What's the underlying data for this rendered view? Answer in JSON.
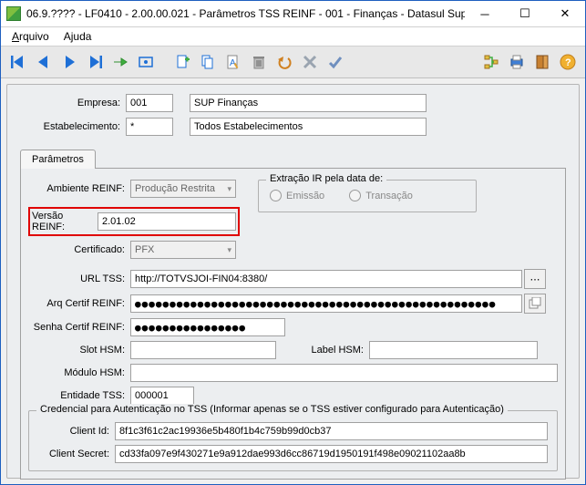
{
  "window": {
    "title": "06.9.???? - LF0410 - 2.00.00.021 - Parâmetros TSS REINF - 001 - Finanças - Datasul Suporte"
  },
  "menu": {
    "arquivo": "Arquivo",
    "ajuda": "Ajuda"
  },
  "toolbar": {
    "first": "first",
    "prev": "prev",
    "next": "next",
    "last": "last",
    "goto": "goto",
    "search": "search",
    "new": "new",
    "copy": "copy",
    "edit": "edit",
    "delete": "delete",
    "undo": "undo",
    "cancel": "cancel",
    "confirm": "confirm",
    "tree": "tree",
    "print": "print",
    "exit": "exit",
    "help": "help"
  },
  "header": {
    "empresa_label": "Empresa:",
    "empresa_code": "001",
    "empresa_name": "SUP Finanças",
    "estab_label": "Estabelecimento:",
    "estab_code": "*",
    "estab_name": "Todos Estabelecimentos"
  },
  "tabs": {
    "parametros": "Parâmetros"
  },
  "form": {
    "ambiente_label": "Ambiente REINF:",
    "ambiente_value": "Produção Restrita",
    "versao_label": "Versão REINF:",
    "versao_value": "2.01.02",
    "certificado_label": "Certificado:",
    "certificado_value": "PFX",
    "url_label": "URL TSS:",
    "url_value": "http://TOTVSJOI-FIN04:8380/",
    "arq_label": "Arq Certif REINF:",
    "arq_value": "●●●●●●●●●●●●●●●●●●●●●●●●●●●●●●●●●●●●●●●●●●●●●●●●●●●●",
    "senha_label": "Senha Certif REINF:",
    "senha_value": "●●●●●●●●●●●●●●●●",
    "slot_label": "Slot HSM:",
    "slot_value": "",
    "labelhsm_label": "Label HSM:",
    "labelhsm_value": "",
    "modulo_label": "Módulo HSM:",
    "modulo_value": "",
    "entidade_label": "Entidade TSS:",
    "entidade_value": "000001"
  },
  "extracao": {
    "legend": "Extração IR pela data de:",
    "emissao": "Emissão",
    "transacao": "Transação"
  },
  "cred": {
    "legend": "Credencial para Autenticação no TSS (Informar apenas se o TSS estiver configurado para Autenticação)",
    "clientid_label": "Client Id:",
    "clientid_value": "8f1c3f61c2ac19936e5b480f1b4c759b99d0cb37",
    "secret_label": "Client Secret:",
    "secret_value": "cd33fa097e9f430271e9a912dae993d6cc86719d1950191f498e09021102aa8b"
  }
}
